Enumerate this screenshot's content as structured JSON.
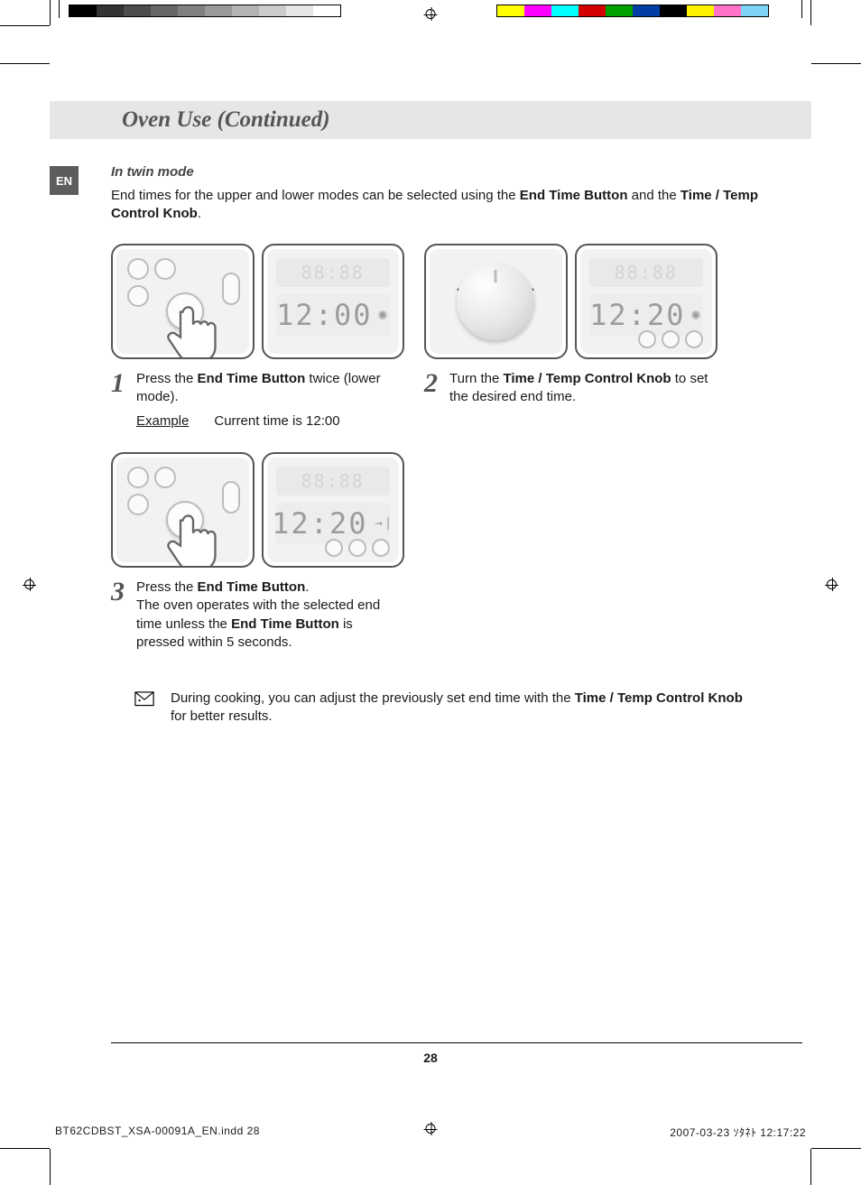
{
  "header": {
    "title": "Oven Use (Continued)"
  },
  "lang_tab": "EN",
  "subhead": "In twin mode",
  "intro": {
    "prefix": "End times for the upper and lower modes can be selected using the ",
    "bold1": "End Time Button",
    "mid": " and the ",
    "bold2": "Time / Temp Control Knob",
    "suffix": "."
  },
  "steps": {
    "one": {
      "num": "1",
      "p1a": "Press the ",
      "p1b": "End Time Button",
      "p1c": " twice (lower mode).",
      "example_label": "Example",
      "example_text": "Current time is 12:00",
      "display_top": "88:88",
      "display_mid": "12:00"
    },
    "two": {
      "num": "2",
      "p1a": "Turn the ",
      "p1b": "Time / Temp Control Knob",
      "p1c": " to set the desired end time.",
      "display_top": "88:88",
      "display_mid": "12:20"
    },
    "three": {
      "num": "3",
      "p1a": "Press the ",
      "p1b": "End Time Button",
      "p1c": ".",
      "p2a": "The oven operates with the selected end time unless the ",
      "p2b": "End Time Button",
      "p2c": " is pressed within 5 seconds.",
      "display_top": "88:88",
      "display_mid": "12:20"
    }
  },
  "note": {
    "p1": "During cooking, you can adjust the previously set end time with the ",
    "b1": "Time / Temp Control Knob",
    "p2": " for better results."
  },
  "page_number": "28",
  "footer": {
    "file": "BT62CDBST_XSA-00091A_EN.indd   28",
    "stamp": "2007-03-23   ｿﾀﾈﾄ 12:17:22"
  },
  "colors": {
    "grays": [
      "#000000",
      "#333333",
      "#4d4d4d",
      "#666666",
      "#808080",
      "#999999",
      "#b3b3b3",
      "#cccccc",
      "#e6e6e6",
      "#ffffff"
    ],
    "cmyk": [
      "#ffff00",
      "#ff00ff",
      "#00ffff",
      "#d40000",
      "#00a000",
      "#003da5",
      "#000000",
      "#fff200",
      "#ff72c7",
      "#7fd3f7"
    ]
  }
}
